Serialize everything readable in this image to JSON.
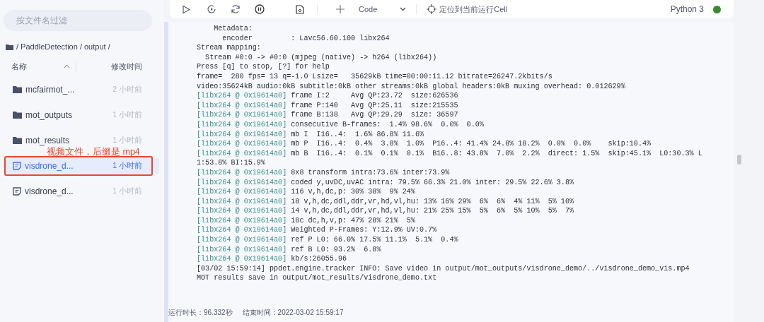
{
  "sidebar": {
    "filter": {
      "placeholder": "按文件名过滤"
    },
    "breadcrumb": "/ PaddleDetection / output /",
    "columns": [
      "名称",
      "修改时间"
    ],
    "files": [
      {
        "kind": "folder",
        "name": "mcfairmot_...",
        "modified": "2 小时前",
        "selected": false
      },
      {
        "kind": "folder",
        "name": "mot_outputs",
        "modified": "1 小时前",
        "selected": false
      },
      {
        "kind": "folder",
        "name": "mot_results",
        "modified": "1 小时前",
        "selected": false
      },
      {
        "kind": "file",
        "name": "visdrone_d...",
        "modified": "1 小时前",
        "selected": true
      },
      {
        "kind": "file",
        "name": "visdrone_d...",
        "modified": "1 小时前",
        "selected": false
      }
    ]
  },
  "annotation": {
    "text": "视频文件，后缀是 mp4"
  },
  "toolbar": {
    "cell_type": "Code",
    "locate": "定位到当前运行Cell",
    "kernel": "Python 3"
  },
  "output": {
    "lines": [
      {
        "kind": "plain",
        "text": "    Metadata:"
      },
      {
        "kind": "plain",
        "text": "      encoder         : Lavc56.60.100 libx264"
      },
      {
        "kind": "plain",
        "text": "Stream mapping:"
      },
      {
        "kind": "plain",
        "text": "  Stream #0:0 -> #0:0 (mjpeg (native) -> h264 (libx264))"
      },
      {
        "kind": "plain",
        "text": "Press [q] to stop, [?] for help"
      },
      {
        "kind": "plain",
        "text": "frame=  280 fps= 13 q=-1.0 Lsize=   35629kB time=00:00:11.12 bitrate=26247.2kbits/s"
      },
      {
        "kind": "plain",
        "text": "video:35624kB audio:0kB subtitle:0kB other streams:0kB global headers:0kB muxing overhead: 0.012629%"
      },
      {
        "kind": "tagged",
        "tag": "[libx264 @ 0x19614a0]",
        "text": "frame I:2     Avg QP:23.72  size:626536"
      },
      {
        "kind": "tagged",
        "tag": "[libx264 @ 0x19614a0]",
        "text": "frame P:140   Avg QP:25.11  size:215535"
      },
      {
        "kind": "tagged",
        "tag": "[libx264 @ 0x19614a0]",
        "text": "frame B:138   Avg QP:29.29  size: 36597"
      },
      {
        "kind": "tagged",
        "tag": "[libx264 @ 0x19614a0]",
        "text": "consecutive B-frames:  1.4% 98.6%  0.0%  0.0%"
      },
      {
        "kind": "tagged",
        "tag": "[libx264 @ 0x19614a0]",
        "text": "mb I  I16..4:  1.6% 86.8% 11.6%"
      },
      {
        "kind": "tagged",
        "tag": "[libx264 @ 0x19614a0]",
        "text": "mb P  I16..4:  0.4%  3.8%  1.0%  P16..4: 41.4% 24.8% 18.2%  0.0%  0.0%    skip:10.4%"
      },
      {
        "kind": "tagged",
        "tag": "[libx264 @ 0x19614a0]",
        "text": "mb B  I16..4:  0.1%  0.1%  0.1%  B16..8: 43.8%  7.0%  2.2%  direct: 1.5%  skip:45.1%  L0:30.3% L"
      },
      {
        "kind": "plain",
        "text": "1:53.8% BI:15.9%"
      },
      {
        "kind": "tagged",
        "tag": "[libx264 @ 0x19614a0]",
        "text": "8x8 transform intra:73.6% inter:73.9%"
      },
      {
        "kind": "tagged",
        "tag": "[libx264 @ 0x19614a0]",
        "text": "coded y,uvDC,uvAC intra: 79.5% 66.3% 21.0% inter: 29.5% 22.6% 3.8%"
      },
      {
        "kind": "tagged",
        "tag": "[libx264 @ 0x19614a0]",
        "text": "i16 v,h,dc,p: 30% 38%  9% 24%"
      },
      {
        "kind": "tagged",
        "tag": "[libx264 @ 0x19614a0]",
        "text": "i8 v,h,dc,ddl,ddr,vr,hd,vl,hu: 13% 16% 29%  6%  6%  4% 11%  5% 10%"
      },
      {
        "kind": "tagged",
        "tag": "[libx264 @ 0x19614a0]",
        "text": "i4 v,h,dc,ddl,ddr,vr,hd,vl,hu: 21% 25% 15%  5%  6%  5% 10%  5%  7%"
      },
      {
        "kind": "tagged",
        "tag": "[libx264 @ 0x19614a0]",
        "text": "i8c dc,h,v,p: 47% 28% 21%  5%"
      },
      {
        "kind": "tagged",
        "tag": "[libx264 @ 0x19614a0]",
        "text": "Weighted P-Frames: Y:12.9% UV:0.7%"
      },
      {
        "kind": "tagged",
        "tag": "[libx264 @ 0x19614a0]",
        "text": "ref P L0: 66.0% 17.5% 11.1%  5.1%  0.4%"
      },
      {
        "kind": "tagged",
        "tag": "[libx264 @ 0x19614a0]",
        "text": "ref B L0: 93.2%  6.8%"
      },
      {
        "kind": "tagged",
        "tag": "[libx264 @ 0x19614a0]",
        "text": "kb/s:26055.96"
      },
      {
        "kind": "plain",
        "text": "[03/02 15:59:14] ppdet.engine.tracker INFO: Save video in output/mot_outputs/visdrone_demo/../visdrone_demo_vis.mp4"
      },
      {
        "kind": "plain",
        "text": "MOT results save in output/mot_results/visdrone_demo.txt"
      }
    ]
  },
  "status": {
    "duration": "运行时长：96.332秒",
    "end_time": "结束时间：2022-03-02 15:59:17"
  }
}
